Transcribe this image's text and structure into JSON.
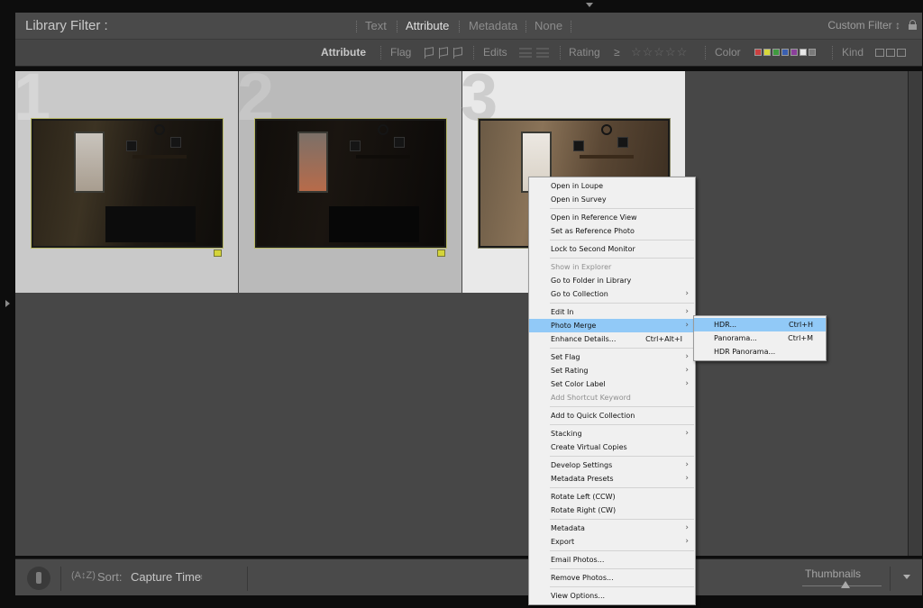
{
  "filter_bar": {
    "title": "Library Filter :",
    "tabs": [
      "Text",
      "Attribute",
      "Metadata",
      "None"
    ],
    "active_tab": "Attribute",
    "custom_filter": "Custom Filter ↕"
  },
  "attribute_bar": {
    "attribute_label": "Attribute",
    "flag_label": "Flag",
    "edits_label": "Edits",
    "rating_label": "Rating",
    "rating_operator": "≥",
    "rating_stars": "☆☆☆☆☆",
    "color_label": "Color",
    "color_swatches": [
      "#c94040",
      "#d8d83a",
      "#3f9a3f",
      "#3a5fb0",
      "#8a3f9a",
      "#e8e8e8",
      "#7a7a7a"
    ],
    "kind_label": "Kind"
  },
  "grid": {
    "cells": [
      {
        "number": "1",
        "color_label": "#d4d43a"
      },
      {
        "number": "2",
        "color_label": "#d4d43a"
      },
      {
        "number": "3"
      }
    ]
  },
  "context_menu": {
    "items": [
      {
        "label": "Open in Loupe"
      },
      {
        "label": "Open in Survey"
      },
      {
        "sep": true
      },
      {
        "label": "Open in Reference View"
      },
      {
        "label": "Set as Reference Photo"
      },
      {
        "sep": true
      },
      {
        "label": "Lock to Second Monitor"
      },
      {
        "sep": true
      },
      {
        "label": "Show in Explorer",
        "disabled": true
      },
      {
        "label": "Go to Folder in Library"
      },
      {
        "label": "Go to Collection",
        "submenu": true
      },
      {
        "sep": true
      },
      {
        "label": "Edit In",
        "submenu": true
      },
      {
        "label": "Photo Merge",
        "submenu": true,
        "highlighted": true
      },
      {
        "label": "Enhance Details...",
        "shortcut": "Ctrl+Alt+I"
      },
      {
        "sep": true
      },
      {
        "label": "Set Flag",
        "submenu": true
      },
      {
        "label": "Set Rating",
        "submenu": true
      },
      {
        "label": "Set Color Label",
        "submenu": true
      },
      {
        "label": "Add Shortcut Keyword",
        "disabled": true
      },
      {
        "sep": true
      },
      {
        "label": "Add to Quick Collection"
      },
      {
        "sep": true
      },
      {
        "label": "Stacking",
        "submenu": true
      },
      {
        "label": "Create Virtual Copies"
      },
      {
        "sep": true
      },
      {
        "label": "Develop Settings",
        "submenu": true
      },
      {
        "label": "Metadata Presets",
        "submenu": true
      },
      {
        "sep": true
      },
      {
        "label": "Rotate Left (CCW)"
      },
      {
        "label": "Rotate Right (CW)"
      },
      {
        "sep": true
      },
      {
        "label": "Metadata",
        "submenu": true
      },
      {
        "label": "Export",
        "submenu": true
      },
      {
        "sep": true
      },
      {
        "label": "Email Photos..."
      },
      {
        "sep": true
      },
      {
        "label": "Remove Photos..."
      },
      {
        "sep": true
      },
      {
        "label": "View Options..."
      }
    ]
  },
  "photo_merge_submenu": {
    "items": [
      {
        "label": "HDR...",
        "shortcut": "Ctrl+H",
        "highlighted": true
      },
      {
        "label": "Panorama...",
        "shortcut": "Ctrl+M"
      },
      {
        "label": "HDR Panorama..."
      }
    ]
  },
  "toolbar": {
    "sort_icon": "(A↕Z)",
    "sort_label": "Sort:",
    "sort_value": "Capture Time",
    "sort_caret": "↕",
    "thumbnails_label": "Thumbnails",
    "thumbnail_size_fraction": 0.55
  }
}
